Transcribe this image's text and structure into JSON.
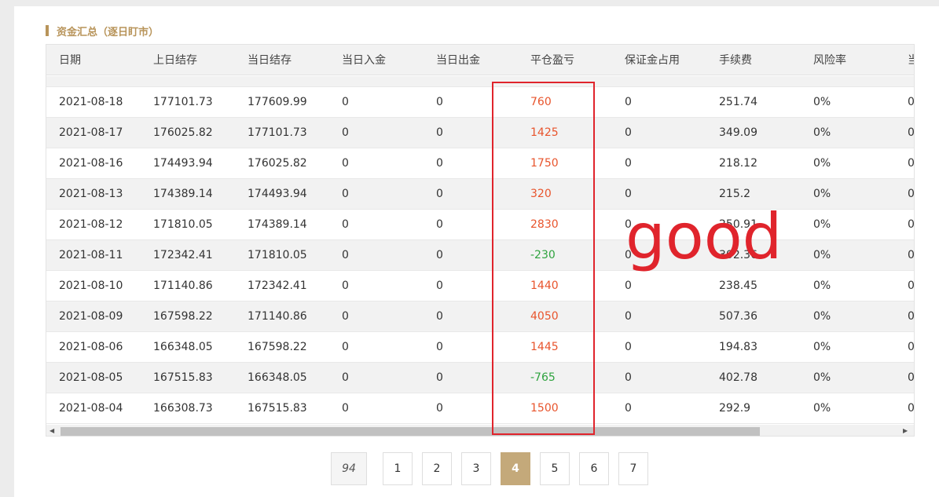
{
  "section": {
    "title": "资金汇总（逐日盯市）"
  },
  "table": {
    "headers": [
      "日期",
      "上日结存",
      "当日结存",
      "当日入金",
      "当日出金",
      "平仓盈亏",
      "保证金占用",
      "手续费",
      "风险率",
      "当日"
    ],
    "rows": [
      [
        "2021-08-18",
        "177101.73",
        "177609.99",
        "0",
        "0",
        "760",
        "0",
        "251.74",
        "0%",
        "0"
      ],
      [
        "2021-08-17",
        "176025.82",
        "177101.73",
        "0",
        "0",
        "1425",
        "0",
        "349.09",
        "0%",
        "0"
      ],
      [
        "2021-08-16",
        "174493.94",
        "176025.82",
        "0",
        "0",
        "1750",
        "0",
        "218.12",
        "0%",
        "0"
      ],
      [
        "2021-08-13",
        "174389.14",
        "174493.94",
        "0",
        "0",
        "320",
        "0",
        "215.2",
        "0%",
        "0"
      ],
      [
        "2021-08-12",
        "171810.05",
        "174389.14",
        "0",
        "0",
        "2830",
        "0",
        "250.91",
        "0%",
        "0"
      ],
      [
        "2021-08-11",
        "172342.41",
        "171810.05",
        "0",
        "0",
        "-230",
        "0",
        "302.36",
        "0%",
        "0"
      ],
      [
        "2021-08-10",
        "171140.86",
        "172342.41",
        "0",
        "0",
        "1440",
        "0",
        "238.45",
        "0%",
        "0"
      ],
      [
        "2021-08-09",
        "167598.22",
        "171140.86",
        "0",
        "0",
        "4050",
        "0",
        "507.36",
        "0%",
        "0"
      ],
      [
        "2021-08-06",
        "166348.05",
        "167598.22",
        "0",
        "0",
        "1445",
        "0",
        "194.83",
        "0%",
        "0"
      ],
      [
        "2021-08-05",
        "167515.83",
        "166348.05",
        "0",
        "0",
        "-765",
        "0",
        "402.78",
        "0%",
        "0"
      ],
      [
        "2021-08-04",
        "166308.73",
        "167515.83",
        "0",
        "0",
        "1500",
        "0",
        "292.9",
        "0%",
        "0"
      ]
    ]
  },
  "annotation": {
    "text": "good",
    "color": "#e0242c"
  },
  "colors": {
    "accent": "#b8945a",
    "profit": "#e8542c",
    "loss": "#2fa33f",
    "active_page": "#c4a97a"
  },
  "pagination": {
    "first": "94",
    "pages": [
      "1",
      "2",
      "3",
      "4",
      "5",
      "6",
      "7"
    ],
    "active": "4"
  },
  "icons": {
    "scroll_up": "▲",
    "scroll_down": "▼",
    "scroll_left": "◀",
    "scroll_right": "▶"
  }
}
